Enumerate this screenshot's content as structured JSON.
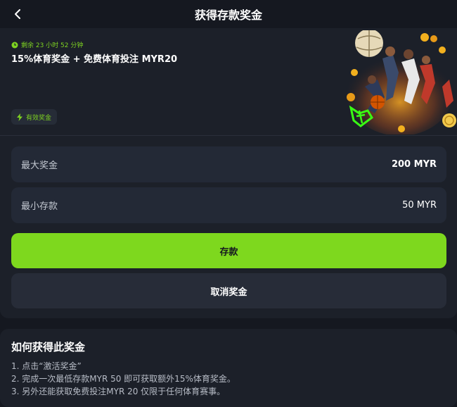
{
  "header": {
    "title": "获得存款奖金",
    "back_icon": "chevron-left-icon"
  },
  "promo": {
    "timer_text": "剩余 23 小时 52 分钟",
    "timer_icon": "clock-icon",
    "title": "15%体育奖金 + 免费体育投注 MYR20",
    "badge_text": "有效奖金",
    "badge_icon": "lightning-icon"
  },
  "details": {
    "rows": [
      {
        "label": "最大奖金",
        "value": "200 MYR"
      },
      {
        "label": "最小存款",
        "value": "50 MYR"
      }
    ]
  },
  "actions": {
    "deposit_label": "存款",
    "cancel_label": "取消奖金"
  },
  "how_to": {
    "title": "如何获得此奖金",
    "steps": [
      "1. 点击“激活奖金”",
      "2. 完成一次最低存款MYR 50 即可获取额外15%体育奖金。",
      "3. 另外还能获取免费投注MYR 20 仅限于任何体育赛事。"
    ]
  },
  "colors": {
    "accent": "#7ed81e",
    "background": "#151820",
    "card": "#1c2029",
    "row": "#232936"
  }
}
